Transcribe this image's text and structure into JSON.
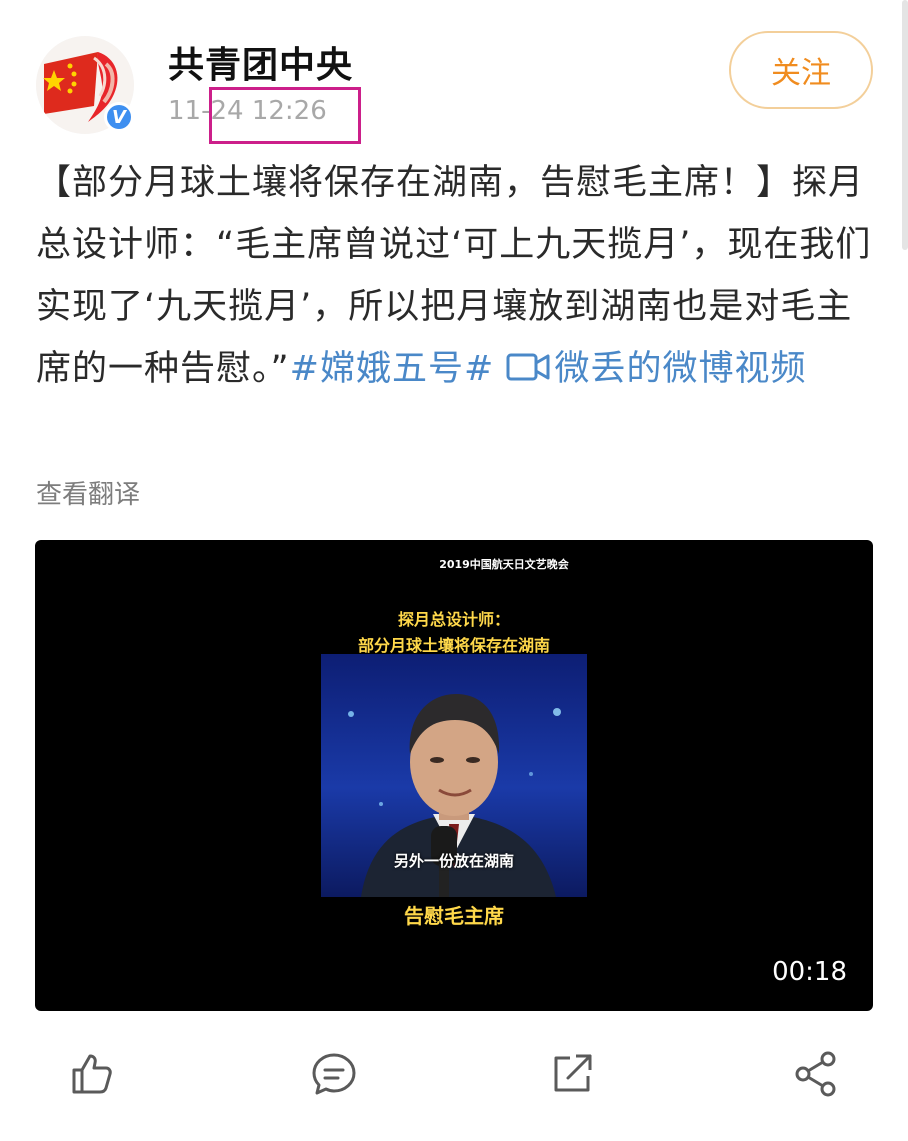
{
  "header": {
    "account_name": "共青团中央",
    "timestamp": "11-24 12:26",
    "follow_label": "关注",
    "verified_badge": "V"
  },
  "post": {
    "text_main": "【部分月球土壤将保存在湖南，告慰毛主席！】探月总设计师：“毛主席曾说过‘可上九天揽月’，现在我们实现了‘九天揽月’，所以把月壤放到湖南也是对毛主席的一种告慰。”",
    "hashtag": "#嫦娥五号#",
    "video_link": "微丢的微博视频",
    "translate_label": "查看翻译"
  },
  "video": {
    "top_title": "2019中国航天日文艺晚会",
    "headline_line1": "探月总设计师：",
    "headline_line2": "部分月球土壤将保存在湖南",
    "subtitle": "另外一份放在湖南",
    "caption": "告慰毛主席",
    "duration": "00:18"
  },
  "actions": {
    "icons": [
      "like-icon",
      "comment-icon",
      "repost-icon",
      "share-icon"
    ]
  },
  "colors": {
    "accent_orange": "#f08c1f",
    "link_blue": "#4a88c8",
    "highlight_box": "#cc1f8a",
    "verified_blue": "#3e8ff0"
  }
}
